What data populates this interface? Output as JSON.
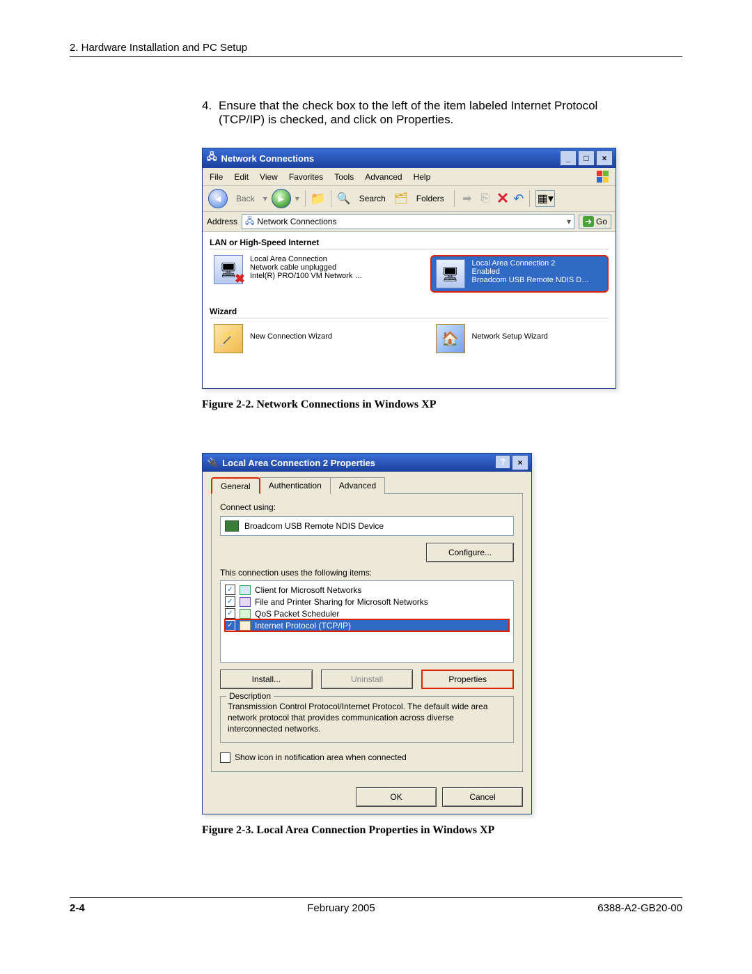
{
  "header": {
    "section": "2. Hardware Installation and PC Setup"
  },
  "step": {
    "number": "4.",
    "text": "Ensure that the check box to the left of the item labeled Internet Protocol (TCP/IP) is checked, and click on Properties."
  },
  "fig1": {
    "window_title": "Network Connections",
    "menus": [
      "File",
      "Edit",
      "View",
      "Favorites",
      "Tools",
      "Advanced",
      "Help"
    ],
    "toolbar": {
      "back": "Back",
      "search": "Search",
      "folders": "Folders",
      "go": "Go"
    },
    "address_label": "Address",
    "address_value": "Network Connections",
    "category1": "LAN or High-Speed Internet",
    "lac1": {
      "title": "Local Area Connection",
      "line2": "Network cable unplugged",
      "line3": "Intel(R) PRO/100 VM Network …"
    },
    "lac2": {
      "title": "Local Area Connection 2",
      "line2": "Enabled",
      "line3": "Broadcom USB Remote NDIS D…"
    },
    "category2": "Wizard",
    "wiz1": "New Connection Wizard",
    "wiz2": "Network Setup Wizard",
    "caption": "Figure 2-2.    Network Connections in Windows XP"
  },
  "fig2": {
    "window_title": "Local Area Connection 2 Properties",
    "tabs": [
      "General",
      "Authentication",
      "Advanced"
    ],
    "connect_using_label": "Connect using:",
    "device": "Broadcom USB Remote NDIS Device",
    "configure_btn": "Configure...",
    "items_label": "This connection uses the following items:",
    "items": [
      "Client for Microsoft Networks",
      "File and Printer Sharing for Microsoft Networks",
      "QoS Packet Scheduler",
      "Internet Protocol (TCP/IP)"
    ],
    "install_btn": "Install...",
    "uninstall_btn": "Uninstall",
    "properties_btn": "Properties",
    "desc_group": "Description",
    "desc_text": "Transmission Control Protocol/Internet Protocol. The default wide area network protocol that provides communication across diverse interconnected networks.",
    "show_icon": "Show icon in notification area when connected",
    "ok": "OK",
    "cancel": "Cancel",
    "caption": "Figure 2-3.    Local Area Connection Properties in Windows XP"
  },
  "footer": {
    "page": "2-4",
    "date": "February 2005",
    "docnum": "6388-A2-GB20-00"
  }
}
